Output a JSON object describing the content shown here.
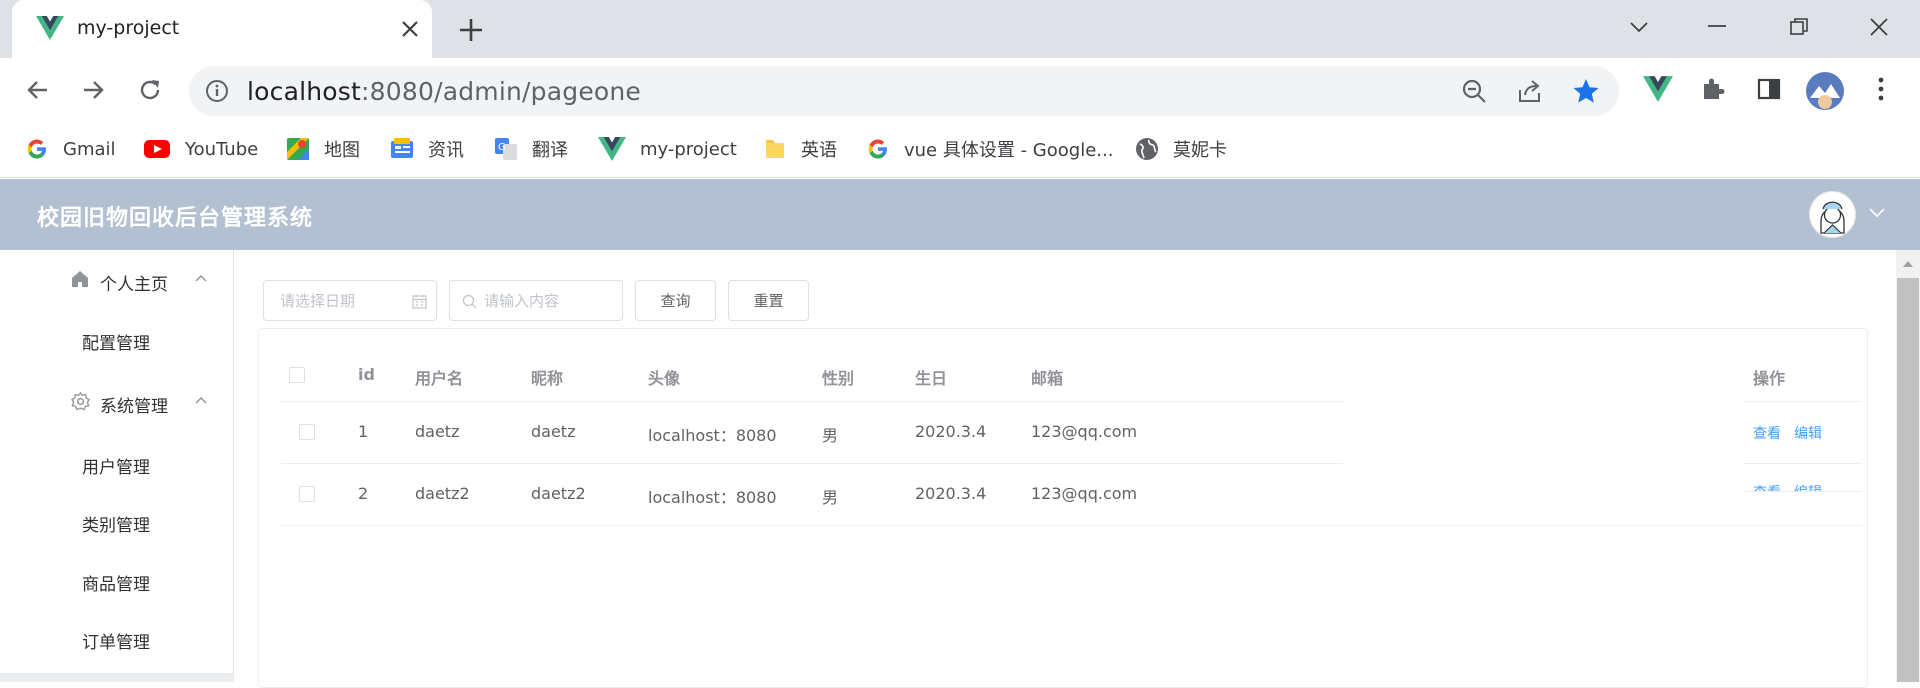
{
  "browser": {
    "tab_title": "my-project",
    "url_host": "localhost",
    "url_rest": ":8080/admin/pageone"
  },
  "bookmarks": [
    {
      "label": "Gmail",
      "icon": "google-icon"
    },
    {
      "label": "YouTube",
      "icon": "youtube-icon"
    },
    {
      "label": "地图",
      "icon": "maps-icon"
    },
    {
      "label": "资讯",
      "icon": "news-icon"
    },
    {
      "label": "翻译",
      "icon": "translate-icon"
    },
    {
      "label": "my-project",
      "icon": "vue-icon"
    },
    {
      "label": "英语",
      "icon": "folder-icon"
    },
    {
      "label": "vue 具体设置 - Google...",
      "icon": "google-icon"
    },
    {
      "label": "莫妮卡",
      "icon": "globe-icon"
    }
  ],
  "app": {
    "title": "校园旧物回收后台管理系统"
  },
  "sidebar": {
    "groups": [
      {
        "label": "个人主页",
        "icon": "home-icon",
        "items": [
          "配置管理"
        ]
      },
      {
        "label": "系统管理",
        "icon": "gear-icon",
        "items": [
          "用户管理",
          "类别管理",
          "商品管理",
          "订单管理"
        ]
      }
    ]
  },
  "filters": {
    "date_placeholder": "请选择日期",
    "search_placeholder": "请输入内容",
    "query_label": "查询",
    "reset_label": "重置"
  },
  "table": {
    "columns": [
      "id",
      "用户名",
      "昵称",
      "头像",
      "性别",
      "生日",
      "邮箱",
      "操作"
    ],
    "rows": [
      {
        "id": "1",
        "username": "daetz",
        "nickname": "daetz",
        "avatar": "localhost：8080",
        "gender": "男",
        "birthday": "2020.3.4",
        "email": "123@qq.com"
      },
      {
        "id": "2",
        "username": "daetz2",
        "nickname": "daetz2",
        "avatar": "localhost：8080",
        "gender": "男",
        "birthday": "2020.3.4",
        "email": "123@qq.com"
      }
    ],
    "actions": {
      "view": "查看",
      "edit": "编辑"
    }
  },
  "colors": {
    "header_bg": "#b3c0d1",
    "link": "#409eff",
    "vue_green": "#41b883",
    "vue_dark": "#35495e",
    "bookmark_star": "#1a73e8"
  }
}
